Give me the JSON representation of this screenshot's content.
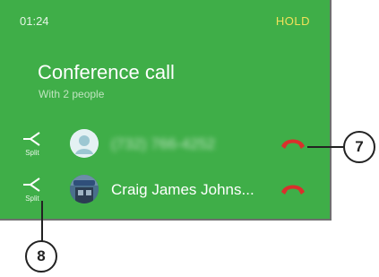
{
  "status": {
    "time": "01:24",
    "hold_label": "HOLD"
  },
  "call": {
    "title": "Conference call",
    "subtitle": "With 2 people"
  },
  "participants": [
    {
      "name": "(732) 766-4252",
      "split_label": "Split",
      "avatar_icon": "contact-placeholder-icon",
      "end_icon": "end-call-icon",
      "blurred": true
    },
    {
      "name": "Craig James Johns...",
      "split_label": "Split",
      "avatar_icon": "contact-photo",
      "end_icon": "end-call-icon",
      "blurred": false
    }
  ],
  "callouts": {
    "end_call": "7",
    "split": "8"
  },
  "colors": {
    "background": "#3fae48",
    "hold": "#f1e15a",
    "end_call": "#d9302c"
  }
}
